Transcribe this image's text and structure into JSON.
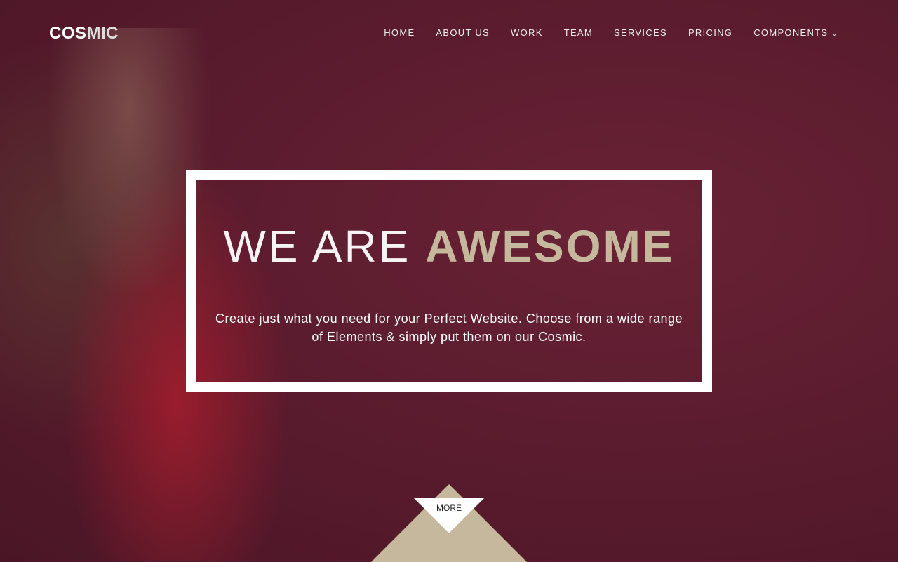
{
  "logo": {
    "part1": "COS",
    "part2": "MIC"
  },
  "nav": [
    "HOME",
    "ABOUT US",
    "WORK",
    "TEAM",
    "SERVICES",
    "PRICING",
    "COMPONENTS"
  ],
  "hero": {
    "title_light": "WE ARE",
    "title_bold": "AWESOME",
    "text": "Create just what you need for your Perfect Website. Choose from a wide range of Elements & simply put them on our Cosmic."
  },
  "more_label": "MORE",
  "colors": {
    "accent": "#c5b89c",
    "background": "#5a1b2e"
  }
}
